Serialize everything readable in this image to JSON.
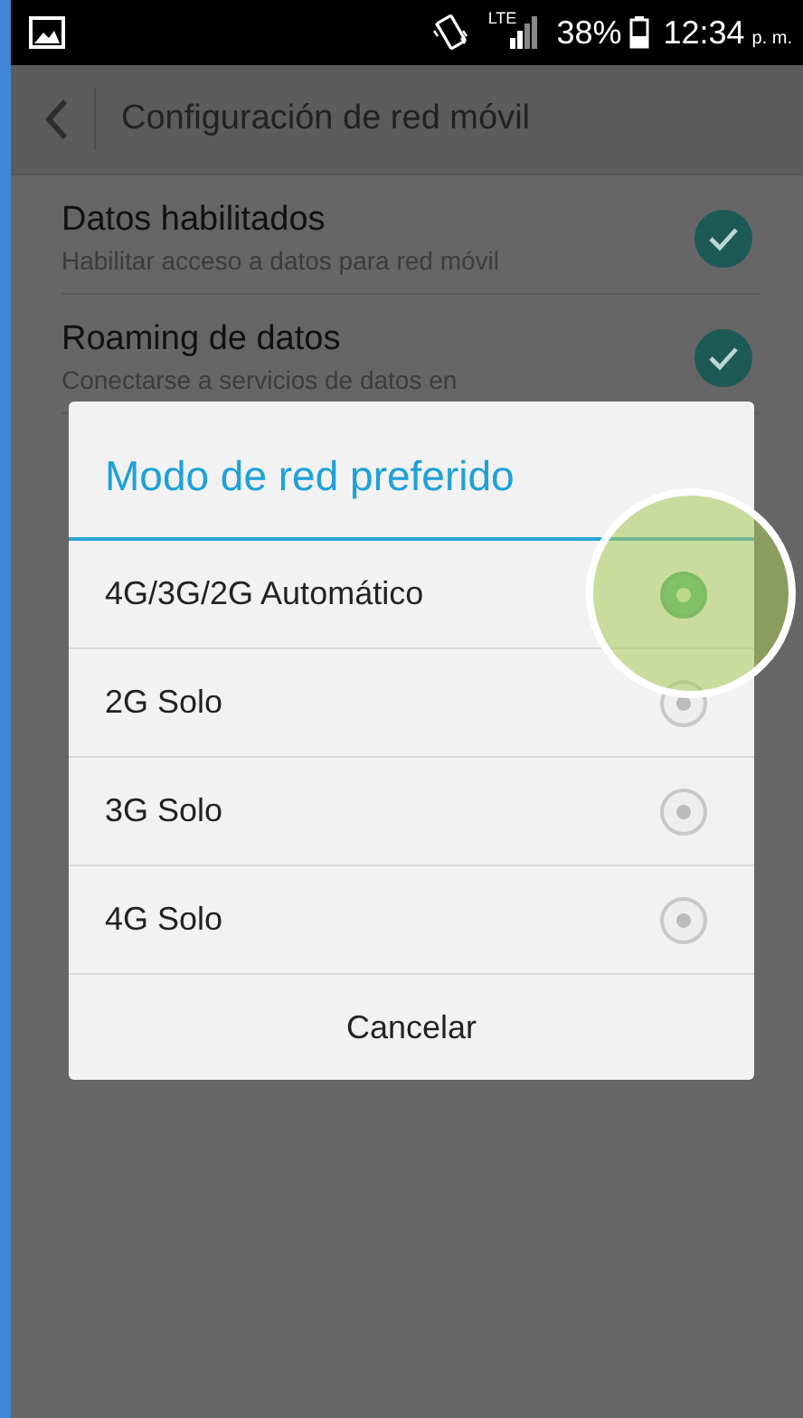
{
  "status_bar": {
    "network": "LTE",
    "battery": "38%",
    "time": "12:34",
    "period": "p. m."
  },
  "action_bar": {
    "title": "Configuración de red móvil"
  },
  "settings": [
    {
      "title": "Datos habilitados",
      "summary": "Habilitar acceso a datos para red móvil",
      "checked": true
    },
    {
      "title": "Roaming de datos",
      "summary": "Conectarse a servicios de datos en",
      "checked": true
    }
  ],
  "dialog": {
    "title": "Modo de red preferido",
    "options": [
      {
        "label": "4G/3G/2G Automático",
        "selected": true
      },
      {
        "label": "2G Solo",
        "selected": false
      },
      {
        "label": "3G Solo",
        "selected": false
      },
      {
        "label": "4G Solo",
        "selected": false
      }
    ],
    "cancel": "Cancelar"
  },
  "touch_highlight": {
    "on": true
  }
}
